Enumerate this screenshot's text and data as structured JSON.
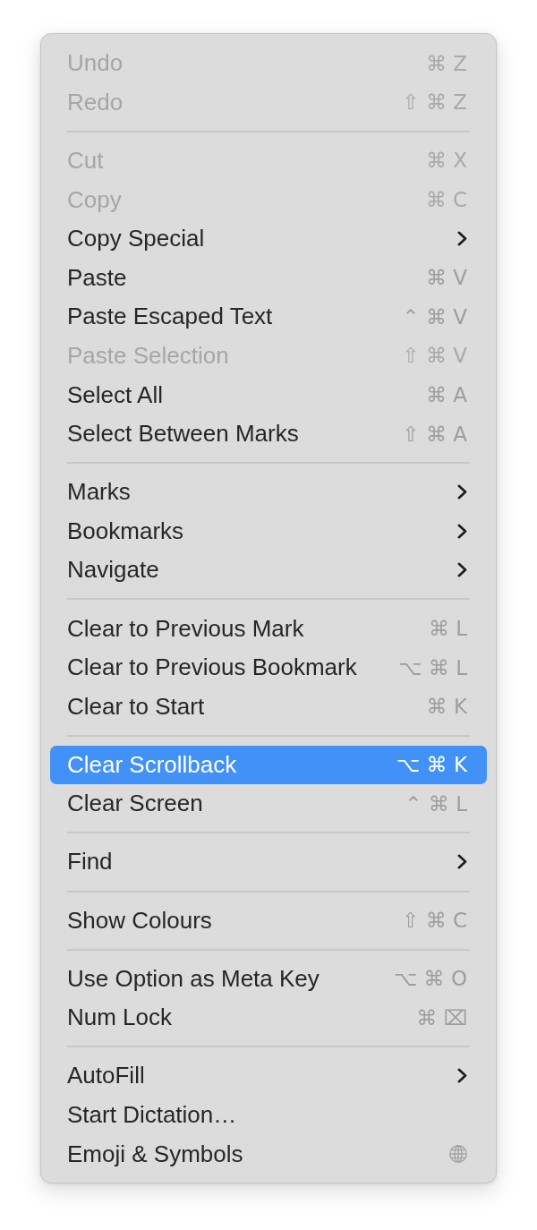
{
  "menu": {
    "sections": [
      {
        "items": [
          {
            "label": "Undo",
            "kind": "shortcut",
            "shortcut": "⌘ Z",
            "disabled": true,
            "selected": false
          },
          {
            "label": "Redo",
            "kind": "shortcut",
            "shortcut": "⇧ ⌘ Z",
            "disabled": true,
            "selected": false
          }
        ]
      },
      {
        "items": [
          {
            "label": "Cut",
            "kind": "shortcut",
            "shortcut": "⌘ X",
            "disabled": true,
            "selected": false
          },
          {
            "label": "Copy",
            "kind": "shortcut",
            "shortcut": "⌘ C",
            "disabled": true,
            "selected": false
          },
          {
            "label": "Copy Special",
            "kind": "submenu",
            "disabled": false,
            "selected": false
          },
          {
            "label": "Paste",
            "kind": "shortcut",
            "shortcut": "⌘ V",
            "disabled": false,
            "selected": false
          },
          {
            "label": "Paste Escaped Text",
            "kind": "shortcut",
            "shortcut": "⌃ ⌘ V",
            "disabled": false,
            "selected": false
          },
          {
            "label": "Paste Selection",
            "kind": "shortcut",
            "shortcut": "⇧ ⌘ V",
            "disabled": true,
            "selected": false
          },
          {
            "label": "Select All",
            "kind": "shortcut",
            "shortcut": "⌘ A",
            "disabled": false,
            "selected": false
          },
          {
            "label": "Select Between Marks",
            "kind": "shortcut",
            "shortcut": "⇧ ⌘ A",
            "disabled": false,
            "selected": false
          }
        ]
      },
      {
        "items": [
          {
            "label": "Marks",
            "kind": "submenu",
            "disabled": false,
            "selected": false
          },
          {
            "label": "Bookmarks",
            "kind": "submenu",
            "disabled": false,
            "selected": false
          },
          {
            "label": "Navigate",
            "kind": "submenu",
            "disabled": false,
            "selected": false
          }
        ]
      },
      {
        "items": [
          {
            "label": "Clear to Previous Mark",
            "kind": "shortcut",
            "shortcut": "⌘ L",
            "disabled": false,
            "selected": false
          },
          {
            "label": "Clear to Previous Bookmark",
            "kind": "shortcut",
            "shortcut": "⌥ ⌘ L",
            "disabled": false,
            "selected": false
          },
          {
            "label": "Clear to Start",
            "kind": "shortcut",
            "shortcut": "⌘ K",
            "disabled": false,
            "selected": false
          }
        ]
      },
      {
        "items": [
          {
            "label": "Clear Scrollback",
            "kind": "shortcut",
            "shortcut": "⌥ ⌘ K",
            "disabled": false,
            "selected": true
          },
          {
            "label": "Clear Screen",
            "kind": "shortcut",
            "shortcut": "⌃ ⌘ L",
            "disabled": false,
            "selected": false
          }
        ]
      },
      {
        "items": [
          {
            "label": "Find",
            "kind": "submenu",
            "disabled": false,
            "selected": false
          }
        ]
      },
      {
        "items": [
          {
            "label": "Show Colours",
            "kind": "shortcut",
            "shortcut": "⇧ ⌘ C",
            "disabled": false,
            "selected": false
          }
        ]
      },
      {
        "items": [
          {
            "label": "Use Option as Meta Key",
            "kind": "shortcut",
            "shortcut": "⌥ ⌘ O",
            "disabled": false,
            "selected": false
          },
          {
            "label": "Num Lock",
            "kind": "shortcut",
            "shortcut": "⌘ ⌧",
            "disabled": false,
            "selected": false
          }
        ]
      },
      {
        "items": [
          {
            "label": "AutoFill",
            "kind": "submenu",
            "disabled": false,
            "selected": false
          },
          {
            "label": "Start Dictation…",
            "kind": "plain",
            "disabled": false,
            "selected": false
          },
          {
            "label": "Emoji & Symbols",
            "kind": "icon",
            "disabled": false,
            "selected": false
          }
        ]
      }
    ]
  }
}
